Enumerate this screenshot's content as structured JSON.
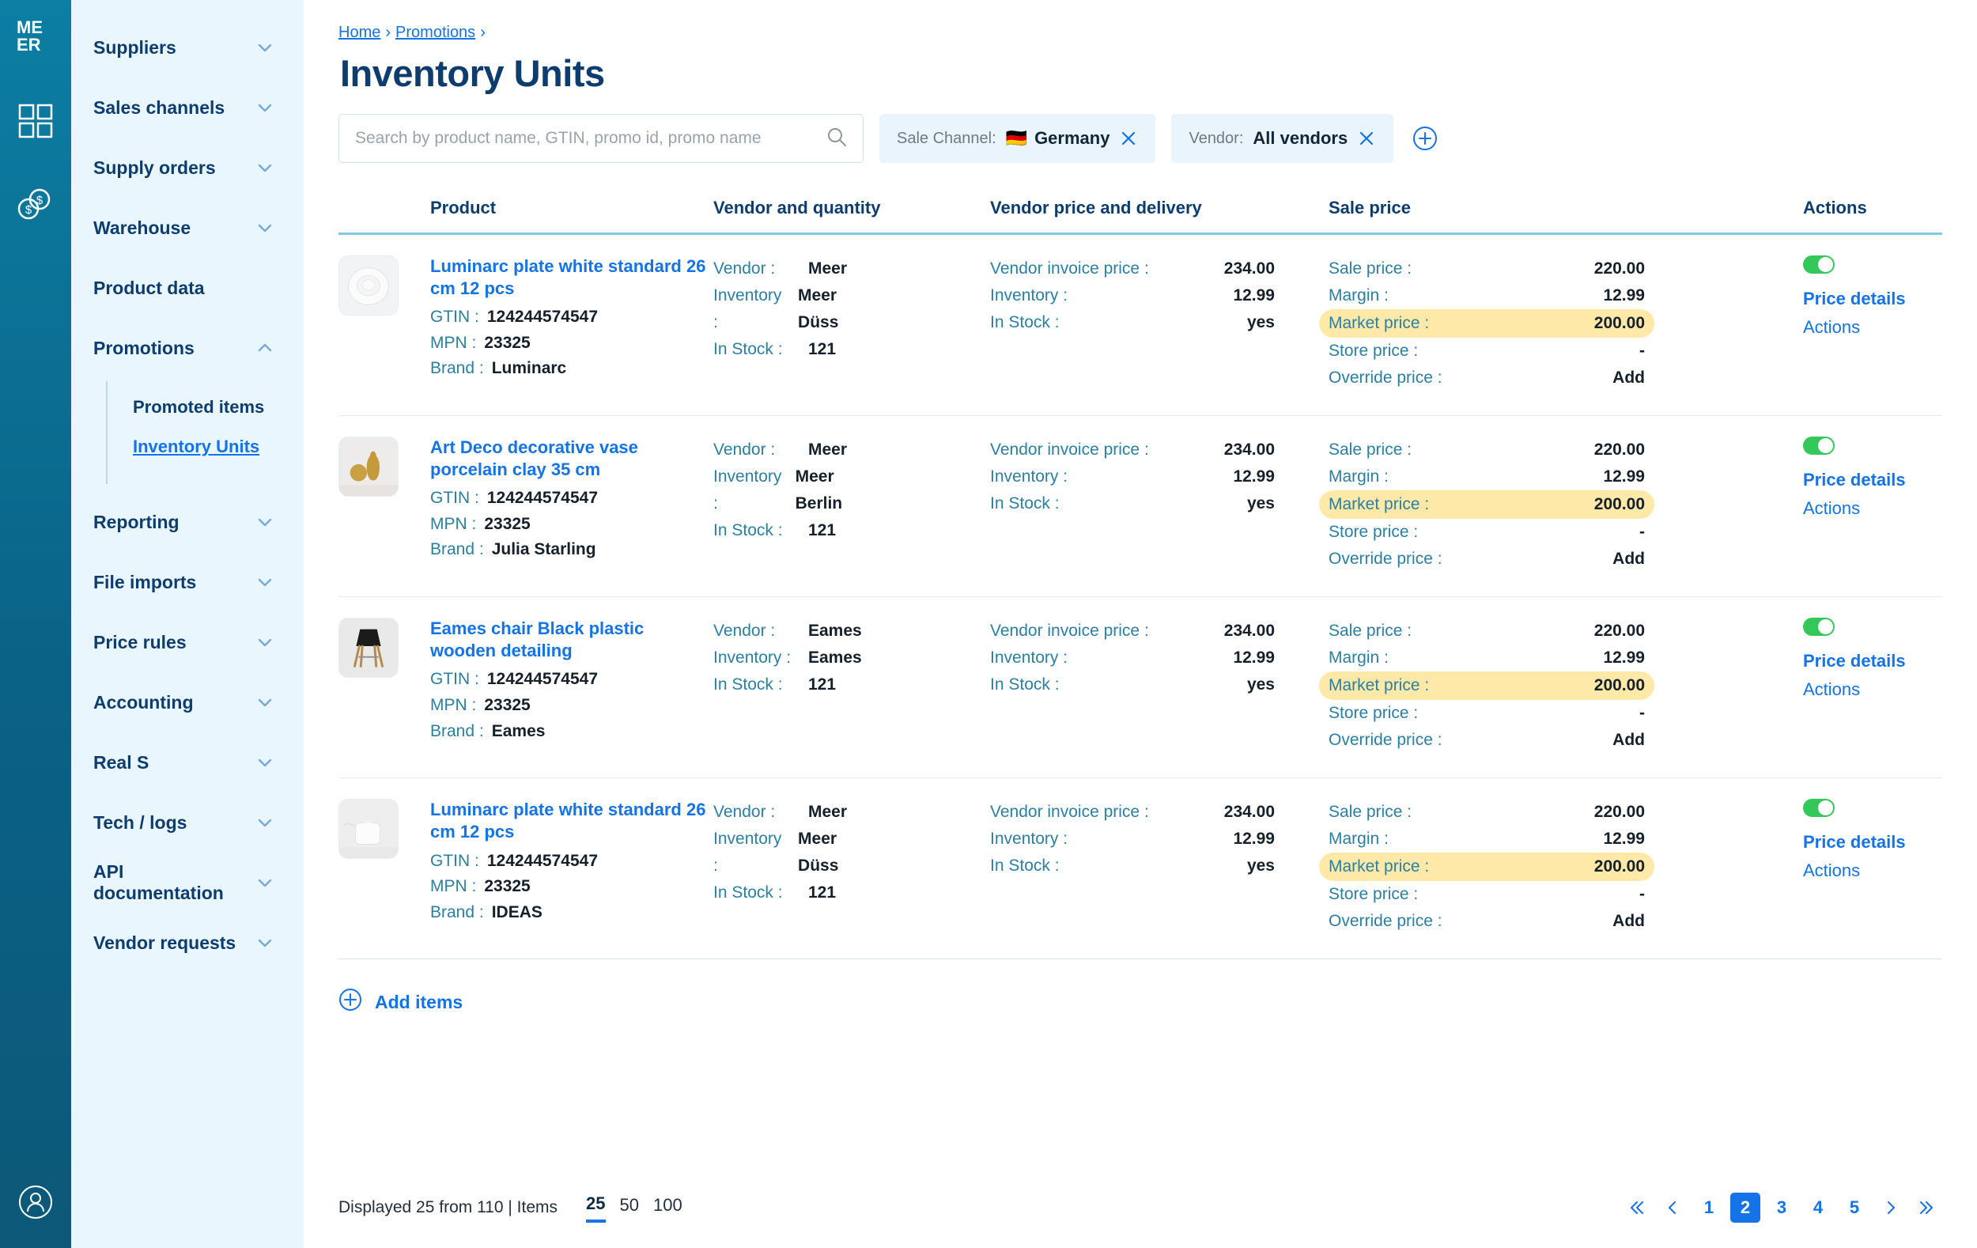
{
  "brand": {
    "logo_line1": "ME",
    "logo_line2": "ER"
  },
  "rail": {
    "dashboard_icon": "grid-icon",
    "finance_icon": "coins-icon",
    "account_icon": "user-circle-icon"
  },
  "sidebar": {
    "items": [
      {
        "label": "Suppliers",
        "expandable": true,
        "expanded": false
      },
      {
        "label": "Sales channels",
        "expandable": true,
        "expanded": false
      },
      {
        "label": "Supply orders",
        "expandable": true,
        "expanded": false
      },
      {
        "label": "Warehouse",
        "expandable": true,
        "expanded": false
      },
      {
        "label": "Product data",
        "expandable": false,
        "expanded": false
      },
      {
        "label": "Promotions",
        "expandable": true,
        "expanded": true
      }
    ],
    "promotions_children": [
      {
        "label": "Promoted items",
        "active": false
      },
      {
        "label": "Inventory Units",
        "active": true
      }
    ],
    "items_after": [
      {
        "label": "Reporting",
        "expandable": true
      },
      {
        "label": "File imports",
        "expandable": true
      },
      {
        "label": "Price rules",
        "expandable": true
      },
      {
        "label": "Accounting",
        "expandable": true
      },
      {
        "label": "Real  S",
        "expandable": true
      },
      {
        "label": "Tech / logs",
        "expandable": true
      },
      {
        "label": "API documentation",
        "expandable": true
      },
      {
        "label": "Vendor requests",
        "expandable": true
      }
    ]
  },
  "breadcrumb": {
    "home": "Home",
    "section": "Promotions",
    "sep": "›"
  },
  "page_title": "Inventory Units",
  "search": {
    "placeholder": "Search by product name, GTIN, promo id, promo name",
    "value": "",
    "icon": "search-icon"
  },
  "chips": [
    {
      "key": "Sale Channel:",
      "value": "Germany",
      "flag": "🇩🇪",
      "close_icon": "close-icon"
    },
    {
      "key": "Vendor:",
      "value": "All vendors",
      "flag": "",
      "close_icon": "close-icon"
    }
  ],
  "add_filter_icon": "plus-circle-icon",
  "table": {
    "headers": [
      "",
      "Product",
      "Vendor and quantity",
      "Vendor price and delivery",
      "Sale price",
      "Actions"
    ],
    "labels": {
      "gtin": "GTIN :",
      "mpn": "MPN :",
      "brand": "Brand :",
      "vendor": "Vendor :",
      "inventory": "Inventory :",
      "in_stock": "In Stock :",
      "vendor_invoice_price": "Vendor invoice price :",
      "sale_price": "Sale price :",
      "margin": "Margin :",
      "market_price": "Market price :",
      "store_price": "Store price :",
      "override_price": "Override price :"
    },
    "action_labels": {
      "price_details": "Price details",
      "actions": "Actions"
    },
    "rows": [
      {
        "thumb": "white-plate-icon",
        "name": "Luminarc plate white standard 26 cm 12 pcs",
        "gtin": "124244574547",
        "mpn": "23325",
        "brand": "Luminarc",
        "vendor": "Meer",
        "vendor_inventory": "Meer Düss",
        "vendor_in_stock": "121",
        "vendor_invoice_price": "234.00",
        "delivery_inventory": "12.99",
        "delivery_in_stock": "yes",
        "sale_price": "220.00",
        "margin": "12.99",
        "market_price": "200.00",
        "store_price": "-",
        "override_price": "Add",
        "toggle_on": true
      },
      {
        "thumb": "gold-vases-icon",
        "name": "Art Deco decorative vase porcelain clay 35 cm",
        "gtin": "124244574547",
        "mpn": "23325",
        "brand": "Julia Starling",
        "vendor": "Meer",
        "vendor_inventory": "Meer Berlin",
        "vendor_in_stock": "121",
        "vendor_invoice_price": "234.00",
        "delivery_inventory": "12.99",
        "delivery_in_stock": "yes",
        "sale_price": "220.00",
        "margin": "12.99",
        "market_price": "200.00",
        "store_price": "-",
        "override_price": "Add",
        "toggle_on": true
      },
      {
        "thumb": "black-chair-icon",
        "name": "Eames chair Black plastic wooden detailing",
        "gtin": "124244574547",
        "mpn": "23325",
        "brand": "Eames",
        "vendor": "Eames",
        "vendor_inventory": "Eames",
        "vendor_in_stock": "121",
        "vendor_invoice_price": "234.00",
        "delivery_inventory": "12.99",
        "delivery_in_stock": "yes",
        "sale_price": "220.00",
        "margin": "12.99",
        "market_price": "200.00",
        "store_price": "-",
        "override_price": "Add",
        "toggle_on": true
      },
      {
        "thumb": "white-kettle-icon",
        "name": "Luminarc plate white standard 26 cm 12 pcs",
        "gtin": "124244574547",
        "mpn": "23325",
        "brand": "IDEAS",
        "vendor": "Meer",
        "vendor_inventory": "Meer Düss",
        "vendor_in_stock": "121",
        "vendor_invoice_price": "234.00",
        "delivery_inventory": "12.99",
        "delivery_in_stock": "yes",
        "sale_price": "220.00",
        "margin": "12.99",
        "market_price": "200.00",
        "store_price": "-",
        "override_price": "Add",
        "toggle_on": true
      }
    ]
  },
  "add_items": {
    "label": "Add items",
    "icon": "plus-circle-icon"
  },
  "footer": {
    "summary": "Displayed 25 from 110  |  Items",
    "page_sizes": [
      "25",
      "50",
      "100"
    ],
    "active_page_size": "25",
    "pages": [
      "1",
      "2",
      "3",
      "4",
      "5"
    ],
    "active_page": "2",
    "first_icon": "chevron-double-left-icon",
    "prev_icon": "chevron-left-icon",
    "next_icon": "chevron-right-icon",
    "last_icon": "chevron-double-right-icon"
  },
  "colors": {
    "brand_teal": "#0a6286",
    "nav_bg": "#eaf6fd",
    "accent_blue": "#1473e6",
    "title_navy": "#0d3d6e",
    "label_teal": "#2b7fa3",
    "highlight_yellow": "#ffe9a8",
    "price_red": "#d0342c",
    "toggle_green": "#34c759",
    "header_rule": "#7fcbe5"
  }
}
